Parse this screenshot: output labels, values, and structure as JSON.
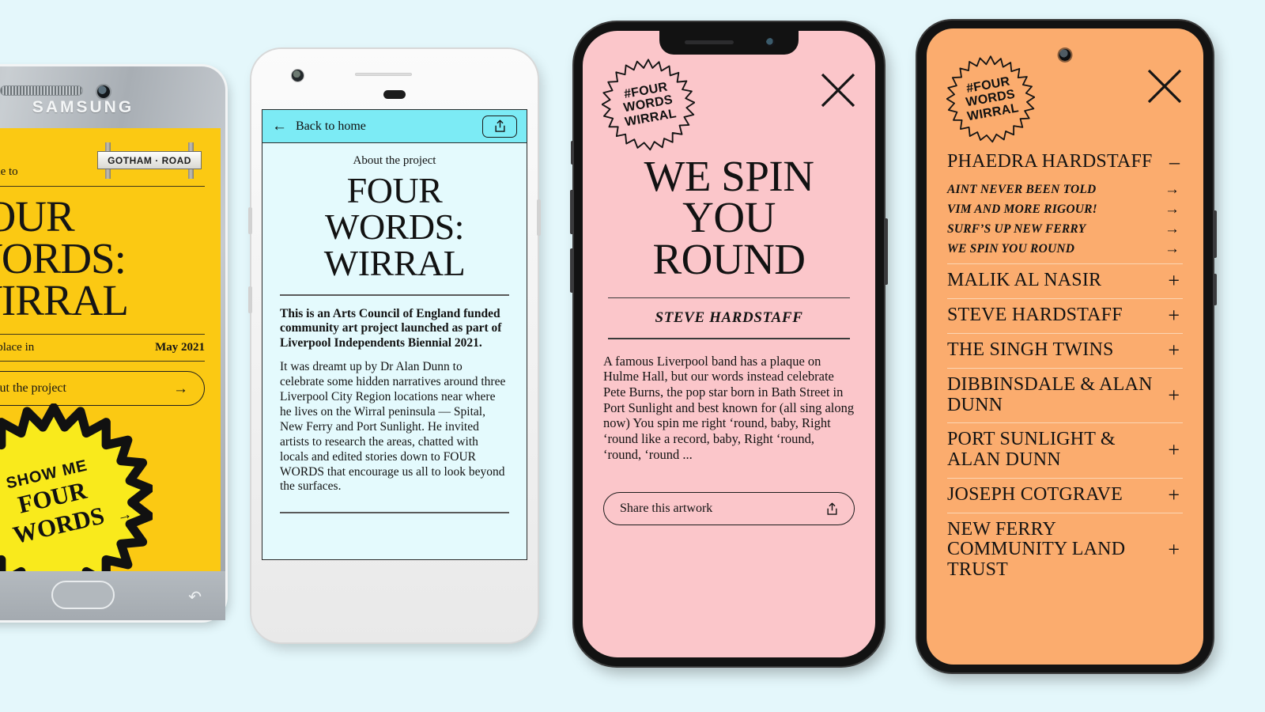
{
  "background_color": "#e4f7fb",
  "palette": {
    "yellow": "#fbc913",
    "cyan": "#7cebf5",
    "pale_cyan": "#e4fafd",
    "pink": "#fbc6ca",
    "orange": "#fbac6e",
    "ink": "#121212"
  },
  "phone1": {
    "device_name": "samsung-galaxy-silver",
    "brand_label": "SAMSUNG",
    "nav": {
      "recents_icon": "recents-icon",
      "home_icon": "home-button",
      "back_icon": "back-icon"
    },
    "screen": {
      "welcome_text": "Welcome to",
      "street_sign_label": "GOTHAM · ROAD",
      "badge_icon": "batman-bat-icon",
      "title": "FOUR WORDS: WIRRAL",
      "meta_label": "Taking place in",
      "meta_value": "May 2021",
      "about_button": "About the project",
      "about_button_icon": "arrow-right-icon",
      "starburst_line1": "SHOW ME",
      "starburst_line2": "FOUR",
      "starburst_line3": "WORDS",
      "starburst_icon": "arrow-right-icon"
    }
  },
  "phone2": {
    "device_name": "white-android-phone",
    "screen": {
      "back_label": "Back to home",
      "back_icon": "arrow-left-icon",
      "share_icon": "share-upload-icon",
      "kicker": "About the project",
      "title": "FOUR WORDS: WIRRAL",
      "lead_paragraph": "This is an Arts Council of England funded community art project launched as part of Liverpool Independents Biennial 2021.",
      "body_paragraph": "It was dreamt up by Dr Alan Dunn to celebrate some hidden narratives around three Liverpool City Region locations near where he lives on the Wirral peninsula — Spital, New Ferry and Port Sunlight. He invited artists to research the areas, chatted with locals and edited stories down to FOUR WORDS that encourage us all to look beyond the surfaces."
    }
  },
  "phone3": {
    "device_name": "black-iphone",
    "screen": {
      "seal_line1": "#FOUR",
      "seal_line2": "WORDS",
      "seal_line3": "WIRRAL",
      "close_icon": "close-x-icon",
      "artwork_title": "WE SPIN YOU ROUND",
      "artist": "STEVE HARDSTAFF",
      "description": "A famous Liverpool band has a plaque on Hulme Hall, but our words instead celebrate Pete Burns, the pop star born in Bath Street in Port Sunlight and best known for (all sing along now) You spin me right ‘round, baby, Right ‘round like a record, baby, Right ‘round, ‘round, ‘round ...",
      "share_label": "Share this artwork",
      "share_icon": "share-upload-icon"
    }
  },
  "phone4": {
    "device_name": "black-android-phone",
    "screen": {
      "seal_line1": "#FOUR",
      "seal_line2": "WORDS",
      "seal_line3": "WIRRAL",
      "close_icon": "close-x-icon",
      "accordion": [
        {
          "name": "PHAEDRA HARDSTAFF",
          "state": "expanded",
          "sign": "–",
          "works": [
            {
              "title": "AINT NEVER BEEN TOLD",
              "icon": "arrow-right-icon"
            },
            {
              "title": "VIM AND MORE RIGOUR!",
              "icon": "arrow-right-icon"
            },
            {
              "title": "SURF’S UP NEW FERRY",
              "icon": "arrow-right-icon"
            },
            {
              "title": "WE SPIN YOU ROUND",
              "icon": "arrow-right-icon"
            }
          ]
        },
        {
          "name": "MALIK AL NASIR",
          "state": "collapsed",
          "sign": "+",
          "works": []
        },
        {
          "name": "STEVE HARDSTAFF",
          "state": "collapsed",
          "sign": "+",
          "works": []
        },
        {
          "name": "THE SINGH TWINS",
          "state": "collapsed",
          "sign": "+",
          "works": []
        },
        {
          "name": "DIBBINSDALE & ALAN DUNN",
          "state": "collapsed",
          "sign": "+",
          "works": []
        },
        {
          "name": "PORT SUNLIGHT & ALAN DUNN",
          "state": "collapsed",
          "sign": "+",
          "works": []
        },
        {
          "name": "JOSEPH COTGRAVE",
          "state": "collapsed",
          "sign": "+",
          "works": []
        },
        {
          "name": "NEW FERRY COMMUNITY LAND TRUST",
          "state": "collapsed",
          "sign": "+",
          "works": []
        }
      ]
    }
  }
}
